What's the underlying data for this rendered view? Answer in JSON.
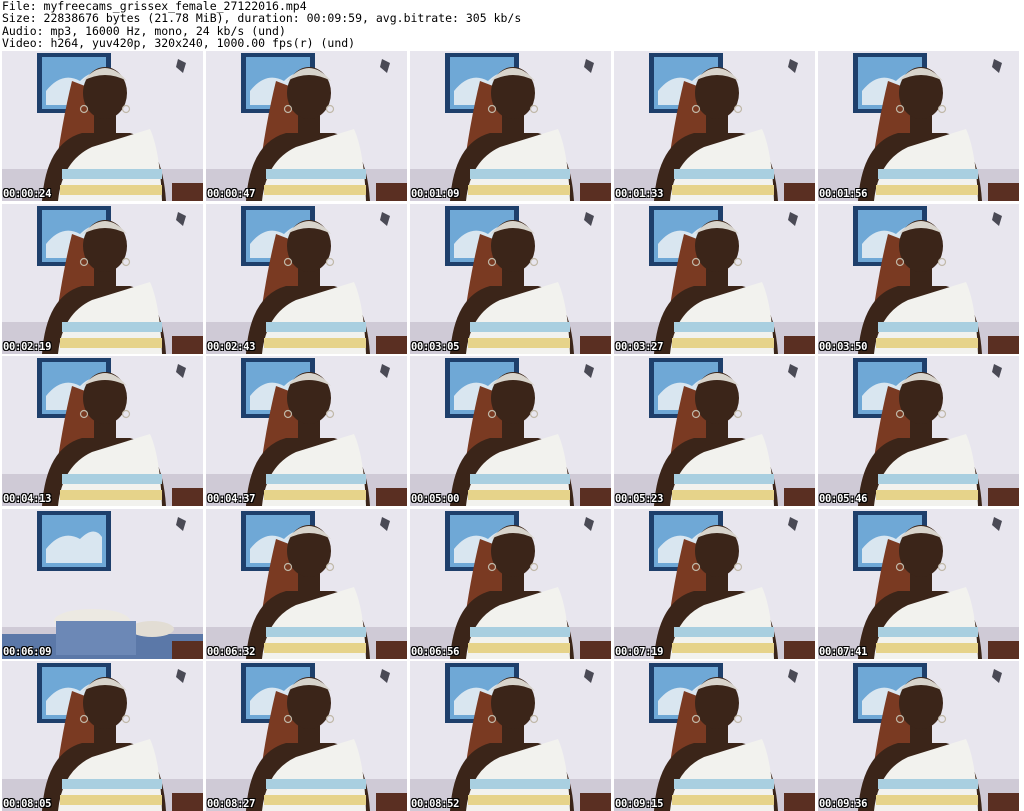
{
  "header": {
    "file": "File: myfreecams_grissex_female_27122016.mp4",
    "size": "Size: 22838676 bytes (21.78 MiB), duration: 00:09:59, avg.bitrate: 305 kb/s",
    "audio": "Audio: mp3, 16000 Hz, mono, 24 kb/s (und)",
    "video": "Video: h264, yuv420p, 320x240, 1000.00 fps(r) (und)"
  },
  "thumbnails": [
    {
      "timestamp": "00:00:24",
      "scene": "person"
    },
    {
      "timestamp": "00:00:47",
      "scene": "person"
    },
    {
      "timestamp": "00:01:09",
      "scene": "person"
    },
    {
      "timestamp": "00:01:33",
      "scene": "person"
    },
    {
      "timestamp": "00:01:56",
      "scene": "person"
    },
    {
      "timestamp": "00:02:19",
      "scene": "person"
    },
    {
      "timestamp": "00:02:43",
      "scene": "person"
    },
    {
      "timestamp": "00:03:05",
      "scene": "person"
    },
    {
      "timestamp": "00:03:27",
      "scene": "person"
    },
    {
      "timestamp": "00:03:50",
      "scene": "person"
    },
    {
      "timestamp": "00:04:13",
      "scene": "person"
    },
    {
      "timestamp": "00:04:37",
      "scene": "person"
    },
    {
      "timestamp": "00:05:00",
      "scene": "person"
    },
    {
      "timestamp": "00:05:23",
      "scene": "person"
    },
    {
      "timestamp": "00:05:46",
      "scene": "person"
    },
    {
      "timestamp": "00:06:09",
      "scene": "empty"
    },
    {
      "timestamp": "00:06:32",
      "scene": "person"
    },
    {
      "timestamp": "00:06:56",
      "scene": "person"
    },
    {
      "timestamp": "00:07:19",
      "scene": "person"
    },
    {
      "timestamp": "00:07:41",
      "scene": "person"
    },
    {
      "timestamp": "00:08:05",
      "scene": "person"
    },
    {
      "timestamp": "00:08:27",
      "scene": "person"
    },
    {
      "timestamp": "00:08:52",
      "scene": "person"
    },
    {
      "timestamp": "00:09:15",
      "scene": "person"
    },
    {
      "timestamp": "00:09:36",
      "scene": "person"
    }
  ],
  "colors": {
    "wall": "#e8e6ee",
    "frame": "#1e3f6b",
    "frame_inner": "#6fa8d6",
    "skin": "#3b2519",
    "hair": "#7a3a22",
    "top_white": "#f2f2ee",
    "top_blue": "#a9cfe0",
    "top_yellow": "#e6d38a",
    "bed": "#5b78a8",
    "headboard": "#5a2f22"
  }
}
